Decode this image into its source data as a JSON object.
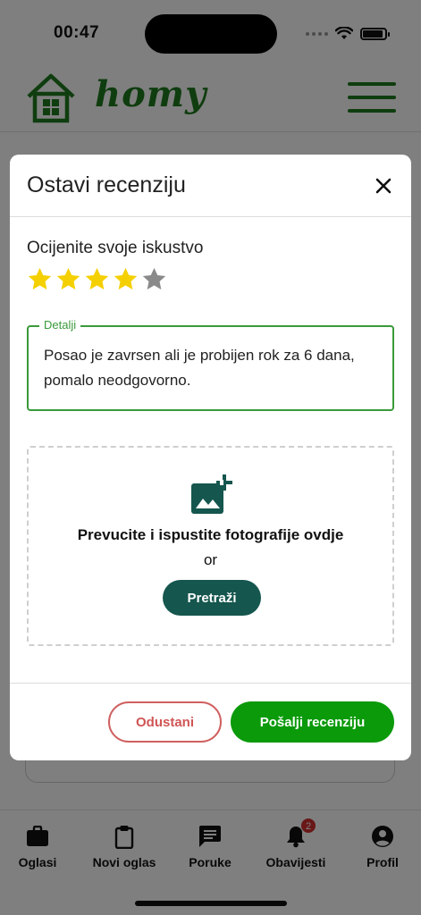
{
  "status_bar": {
    "time": "00:47",
    "battery_level": 0.9
  },
  "header": {
    "logo_text": "homy",
    "logo_icon": "house-icon",
    "menu_icon": "hamburger-menu-icon"
  },
  "bottom_nav": {
    "items": [
      {
        "label": "Oglasi",
        "icon": "briefcase-icon"
      },
      {
        "label": "Novi oglas",
        "icon": "clipboard-icon"
      },
      {
        "label": "Poruke",
        "icon": "chat-icon"
      },
      {
        "label": "Obavijesti",
        "icon": "bell-icon",
        "badge": "2"
      },
      {
        "label": "Profil",
        "icon": "account-circle-icon"
      }
    ]
  },
  "modal": {
    "title": "Ostavi recenziju",
    "close_icon": "close-icon",
    "rating_label": "Ocijenite svoje iskustvo",
    "rating": {
      "value": 4,
      "max": 5,
      "filled_color": "#f5d000",
      "empty_color": "#8a8a8a"
    },
    "details": {
      "legend": "Detalji",
      "value": "Posao je zavrsen ali je probijen rok za 6 dana, pomalo neodgovorno."
    },
    "upload": {
      "icon": "add-photo-icon",
      "title": "Prevucite i ispustite fotografije ovdje",
      "or_text": "or",
      "browse_label": "Pretraži"
    },
    "cancel_label": "Odustani",
    "submit_label": "Pošalji recenziju"
  },
  "colors": {
    "brand_green": "#1f7a1f",
    "field_border": "#3a9a3a",
    "browse_button": "#15564e",
    "submit_button": "#0a9a0a",
    "cancel_border": "#d06060",
    "badge": "#d32f2f"
  }
}
